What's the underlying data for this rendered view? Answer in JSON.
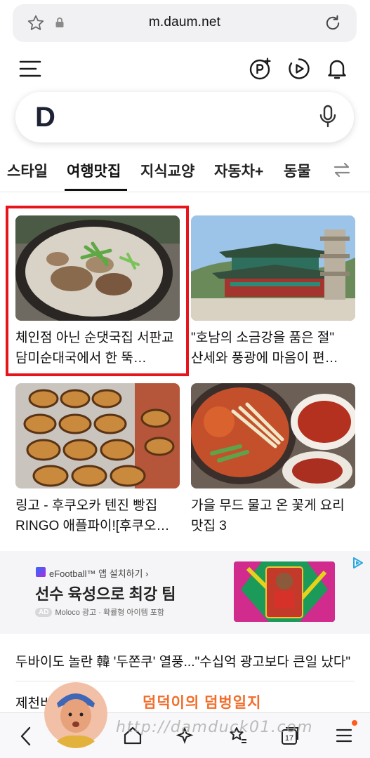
{
  "browser": {
    "url": "m.daum.net"
  },
  "search": {
    "logo": "D"
  },
  "tabs": [
    "스타일",
    "여행맛집",
    "지식교양",
    "자동차+",
    "동물"
  ],
  "cards": [
    {
      "title": "체인점 아닌 순댓국집 서판교 담미순대국에서 한 뚝배기",
      "display": "체인점 아닌 순댓국집 서판교 담미순대국에서 한 뚝…"
    },
    {
      "title": "\"호남의 소금강을 품은 절\" 산세와 풍광에 마음이 편…",
      "display": "\"호남의 소금강을 품은 절\" 산세와 풍광에 마음이 편…"
    },
    {
      "title": "링고 - 후쿠오카 텐진 빵집 RINGO 애플파이![후쿠오…",
      "display": "링고 - 후쿠오카 텐진 빵집 RINGO 애플파이![후쿠오…"
    },
    {
      "title": "가을 무드 물고 온 꽃게 요리 맛집 3",
      "display": "가을 무드 물고 온 꽃게 요리 맛집 3"
    }
  ],
  "ad": {
    "brand": "eFootball™ 앱 설치하기 ›",
    "headline": "선수 육성으로 최강 팀",
    "badge": "AD",
    "meta": "Moloco 광고 · 확률형 아이템 포함"
  },
  "news": [
    "두바이도 놀란 韓 '두쫀쿠' 열풍...\"수십억 광고보다 큰일 났다\"",
    "제천비…설매장"
  ],
  "watermark": {
    "text": "덤덕이의 덤벙일지",
    "url": "http://damduck01.com"
  },
  "bottom_nav": {
    "tab_count": "17"
  },
  "colors": {
    "highlight": "#e8141c",
    "logo": "#1d2234",
    "notification_dot": "#ff5a1f"
  }
}
